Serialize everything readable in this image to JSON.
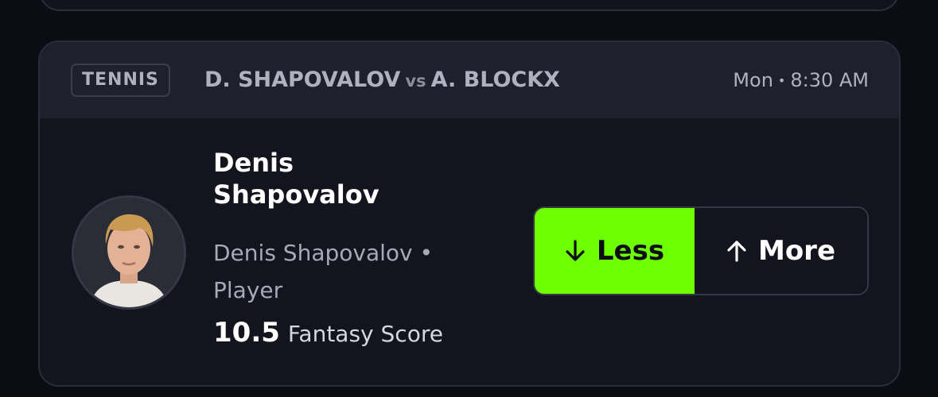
{
  "header": {
    "sport_badge": "TENNIS",
    "player_one": "D. SHAPOVALOV",
    "vs": "vs",
    "player_two": "A. BLOCKX",
    "day": "Mon",
    "time": "8:30 AM"
  },
  "player": {
    "name": "Denis Shapovalov",
    "subtitle": "Denis Shapovalov • Player",
    "line_value": "10.5",
    "stat_name": "Fantasy Score"
  },
  "picks": {
    "less_label": "Less",
    "more_label": "More",
    "less_icon": "arrow-down-icon",
    "more_icon": "arrow-up-icon",
    "selected": "less"
  },
  "colors": {
    "accent": "#6eff00",
    "background": "#0b0c14",
    "card": "#13141e",
    "header": "#1e202b"
  }
}
